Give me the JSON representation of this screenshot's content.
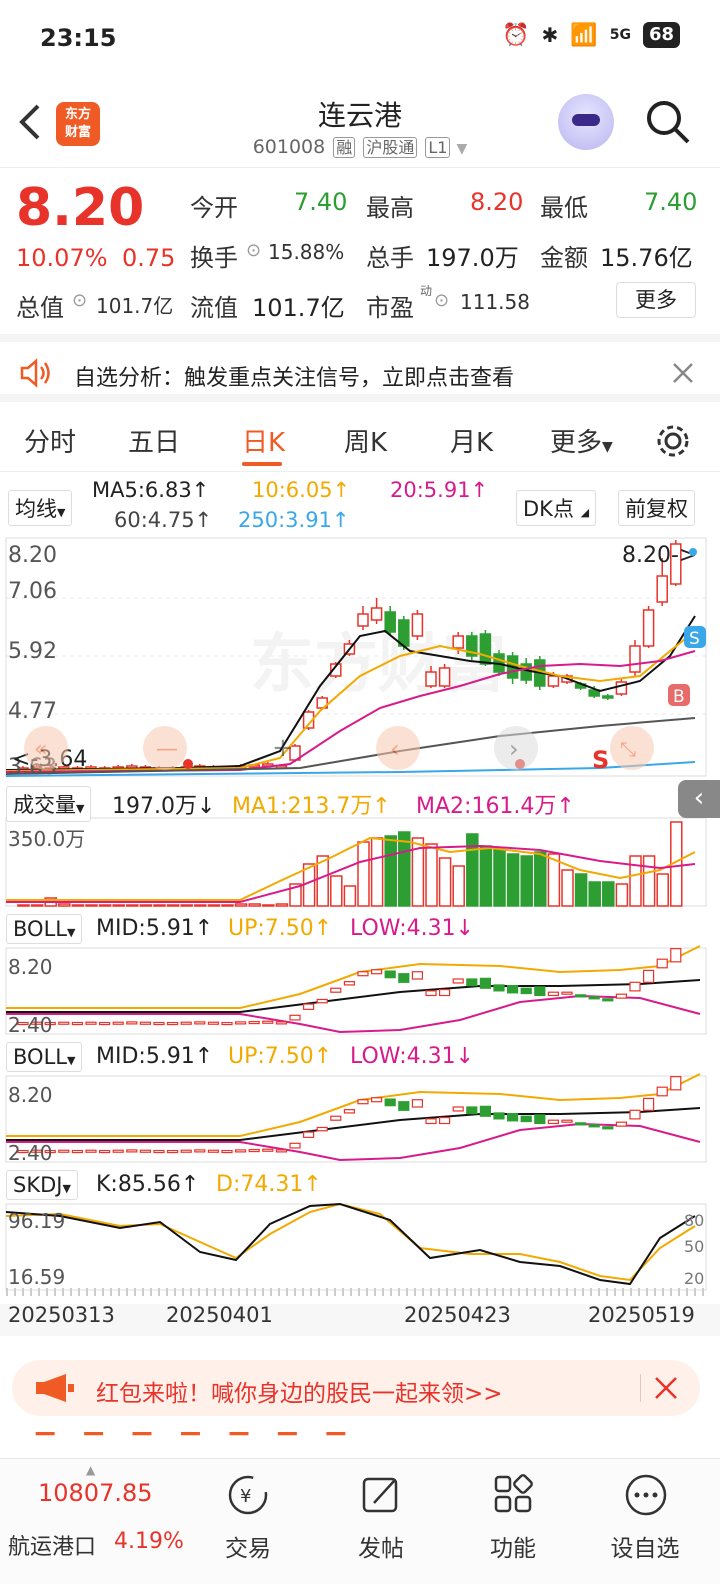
{
  "status_bar": {
    "time": "23:15",
    "battery": "68",
    "network": "5G"
  },
  "header": {
    "back_label": "<",
    "logo_text": "东方财富",
    "stock_name": "连云港",
    "stock_code": "601008",
    "tags": [
      "融",
      "沪股通",
      "L1"
    ]
  },
  "quote": {
    "price": "8.20",
    "change_pct": "10.07%",
    "change_amt": "0.75",
    "open_label": "今开",
    "open": "7.40",
    "high_label": "最高",
    "high": "8.20",
    "low_label": "最低",
    "low": "7.40",
    "turnover_label": "换手",
    "turnover": "15.88%",
    "volume_label": "总手",
    "volume": "197.0万",
    "amount_label": "金额",
    "amount": "15.76亿",
    "mktcap_label": "总值",
    "mktcap": "101.7亿",
    "float_label": "流值",
    "float": "101.7亿",
    "pe_label": "市盈",
    "pe_sup": "动",
    "pe": "111.58",
    "more_label": "更多"
  },
  "notice": {
    "text": "自选分析：触发重点关注信号，立即点击查看"
  },
  "tabs": [
    "分时",
    "五日",
    "日K",
    "周K",
    "月K",
    "更多"
  ],
  "active_tab": "日K",
  "ma_bar": {
    "selector": "均线",
    "ma5": "MA5:6.83↑",
    "ma10": "10:6.05↑",
    "ma20": "20:5.91↑",
    "ma60": "60:4.75↑",
    "ma250": "250:3.91↑",
    "dk_label": "DK点",
    "adjust_label": "前复权"
  },
  "kline": {
    "y_labels": [
      "8.20",
      "7.06",
      "5.92",
      "4.77",
      "3.63"
    ],
    "last_price_tag": "8.20->",
    "low_marker": "<-3.64",
    "buy_marker": "B",
    "sell_marker": "S"
  },
  "volume_panel": {
    "selector": "成交量",
    "value": "197.0万↓",
    "ma1": "MA1:213.7万↑",
    "ma2": "MA2:161.4万↑",
    "y_label": "350.0万"
  },
  "boll1": {
    "selector": "BOLL",
    "mid": "MID:5.91↑",
    "up": "UP:7.50↑",
    "low": "LOW:4.31↓",
    "y_top": "8.20",
    "y_bottom": "2.40"
  },
  "boll2": {
    "selector": "BOLL",
    "mid": "MID:5.91↑",
    "up": "UP:7.50↑",
    "low": "LOW:4.31↓",
    "y_top": "8.20",
    "y_bottom": "2.40"
  },
  "skdj": {
    "selector": "SKDJ",
    "k": "K:85.56↑",
    "d": "D:74.31↑",
    "y_top": "96.19",
    "y_bottom": "16.59",
    "right_ticks": [
      "80",
      "50",
      "20"
    ]
  },
  "dates": [
    "20250313",
    "20250401",
    "20250423",
    "20250519"
  ],
  "banner": {
    "text": "红包来啦！喊你身边的股民一起来领>>"
  },
  "bottom_nav": {
    "index_value": "10807.85",
    "index_name": "航运港口",
    "index_change": "4.19%",
    "items": [
      "交易",
      "发帖",
      "功能",
      "设自选"
    ]
  },
  "colors": {
    "up": "#e8332a",
    "down": "#2c9e32",
    "accent": "#f05a24"
  }
}
